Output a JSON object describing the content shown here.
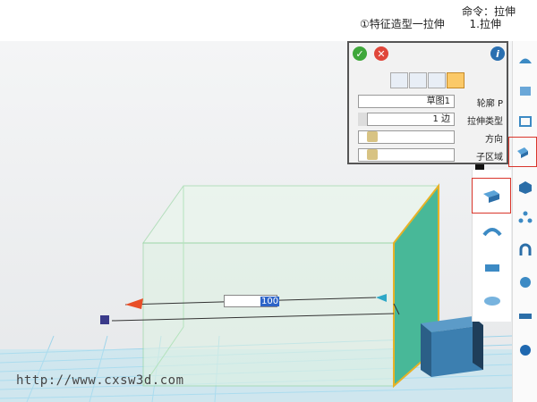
{
  "command": {
    "title": "命令：拉伸",
    "step": "1.拉伸",
    "hint": "①特征造型一拉伸"
  },
  "panel": {
    "rows": [
      {
        "label": "轮廓 P",
        "value": "草图1"
      },
      {
        "label": "拉伸类型",
        "value": "1 边"
      },
      {
        "label": "方向",
        "value": ""
      },
      {
        "label": "子区域",
        "value": ""
      }
    ]
  },
  "viewport": {
    "dimension_value": "100",
    "watermark": "http://www.cxsw3d.com"
  },
  "colors": {
    "accent_red": "#d9352b",
    "ok_green": "#3fa73a",
    "cancel_red": "#e0463a",
    "face_teal": "#48b898",
    "box_blue": "#3c7fb0"
  }
}
